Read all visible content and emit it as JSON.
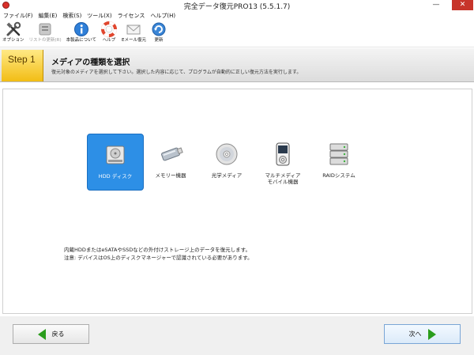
{
  "window": {
    "title": "完全データ復元PRO13 (5.5.1.7)",
    "minimize": "—",
    "maximize": "□",
    "close": "✕"
  },
  "menu": [
    {
      "label": "ファイル(F)"
    },
    {
      "label": "編集(E)"
    },
    {
      "label": "検索(S)"
    },
    {
      "label": "ツール(X)"
    },
    {
      "label": "ライセンス"
    },
    {
      "label": "ヘルプ(H)"
    }
  ],
  "toolbar": [
    {
      "label": "オプション",
      "icon": "tools-icon",
      "enabled": true
    },
    {
      "label": "リストの更新(R)",
      "icon": "list-refresh-icon",
      "enabled": false
    },
    {
      "label": "本製品について",
      "icon": "info-icon",
      "enabled": true
    },
    {
      "label": "ヘルプ",
      "icon": "lifebuoy-icon",
      "enabled": true
    },
    {
      "label": "Eメール復元",
      "icon": "email-icon",
      "enabled": true
    },
    {
      "label": "更新",
      "icon": "update-icon",
      "enabled": true
    }
  ],
  "step": {
    "badge": "Step 1",
    "title": "メディアの種類を選択",
    "description": "復元対象のメディアを選択して下さい。選択した内容に応じて、プログラムが自動的に正しい復元方法を実行します。"
  },
  "media": [
    {
      "label": "HDD ディスク",
      "icon": "hard-disk-icon",
      "selected": true
    },
    {
      "label": "メモリー機器",
      "icon": "usb-drive-icon",
      "selected": false
    },
    {
      "label": "光学メディア",
      "icon": "optical-disc-icon",
      "selected": false
    },
    {
      "label": "マルチメディア\nモバイル機器",
      "icon": "media-player-icon",
      "selected": false
    },
    {
      "label": "RAIDシステム",
      "icon": "raid-icon",
      "selected": false
    }
  ],
  "description_lines": [
    "内蔵HDDまたはeSATAやSSDなどの外付けストレージ上のデータを復元します。",
    "注意: デバイスはOS上のディスクマネージャーで認識されている必要があります。"
  ],
  "nav": {
    "back_label": "戻る",
    "next_label": "次へ"
  },
  "colors": {
    "selected_bg": "#2d8fe6",
    "step_badge": "#f2bd14",
    "arrow_green": "#2a9d1c",
    "close_red": "#c7352a"
  }
}
